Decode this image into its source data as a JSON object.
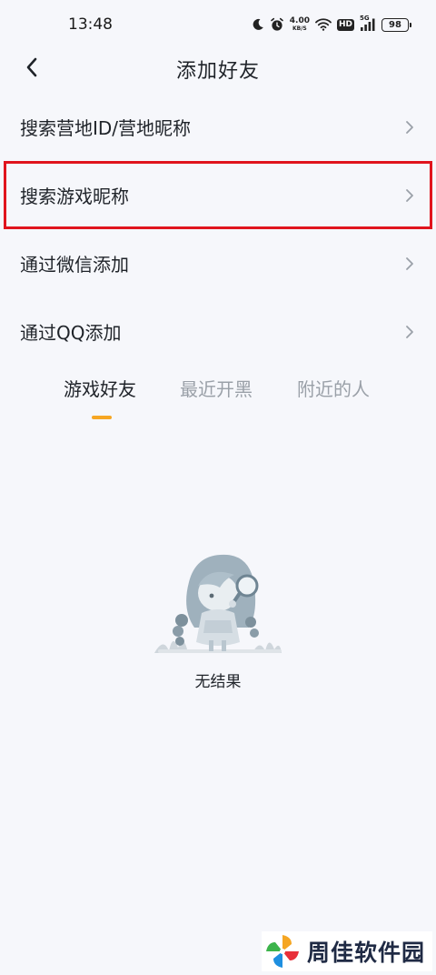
{
  "status_bar": {
    "time": "13:48",
    "net_speed_value": "4.00",
    "net_speed_unit": "KB/S",
    "hd_label": "HD",
    "signal_label": "5G",
    "battery_level": "98"
  },
  "header": {
    "title": "添加好友"
  },
  "menu": {
    "items": [
      {
        "label": "搜索营地ID/营地昵称"
      },
      {
        "label": "搜索游戏昵称"
      },
      {
        "label": "通过微信添加"
      },
      {
        "label": "通过QQ添加"
      }
    ]
  },
  "tabs": {
    "items": [
      {
        "label": "游戏好友"
      },
      {
        "label": "最近开黑"
      },
      {
        "label": "附近的人"
      }
    ],
    "active_index": 0,
    "indicator_color": "#f6a623"
  },
  "empty_state": {
    "text": "无结果"
  },
  "watermark": {
    "text": "周佳软件园"
  },
  "colors": {
    "highlight_box": "#e0141d",
    "background": "#f6f7fb"
  }
}
